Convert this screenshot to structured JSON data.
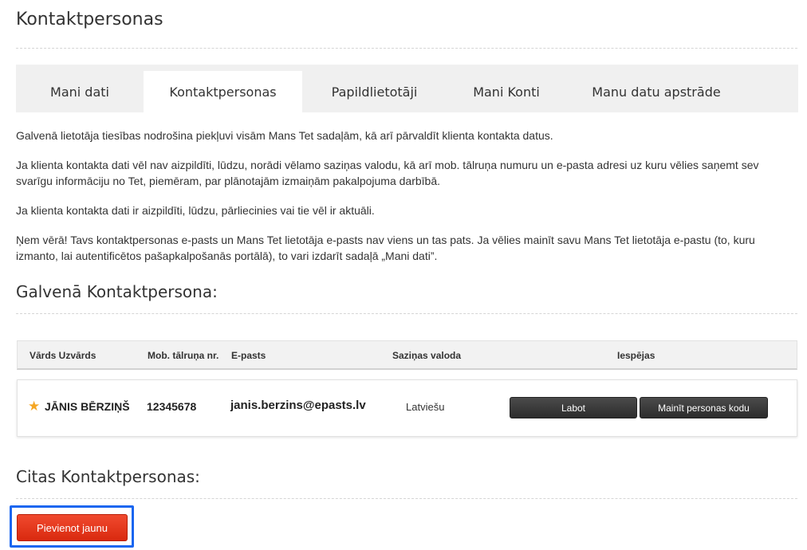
{
  "page_title": "Kontaktpersonas",
  "tabs": [
    {
      "label": "Mani dati"
    },
    {
      "label": "Kontaktpersonas"
    },
    {
      "label": "Papildlietotāji"
    },
    {
      "label": "Mani Konti"
    },
    {
      "label": "Manu datu apstrāde"
    }
  ],
  "active_tab": "Kontaktpersonas",
  "intro": [
    "Galvenā lietotāja tiesības nodrošina piekļuvi visām Mans Tet sadaļām, kā arī pārvaldīt klienta kontakta datus.",
    "Ja klienta kontakta dati vēl nav aizpildīti, lūdzu, norādi vēlamo saziņas valodu, kā arī mob. tālruņa numuru un e-pasta adresi uz kuru vēlies saņemt sev svarīgu informāciju no Tet, piemēram, par plānotajām izmaiņām pakalpojuma darbībā.",
    "Ja klienta kontakta dati ir aizpildīti, lūdzu, pārliecinies vai tie vēl ir aktuāli.",
    "Ņem vērā! Tavs kontaktpersonas e-pasts un Mans Tet lietotāja e-pasts nav viens un tas pats. Ja vēlies mainīt savu Mans Tet lietotāja e-pastu (to, kuru izmanto, lai autentificētos pašapkalpošanās portālā), to vari izdarīt sadaļā „Mani dati”."
  ],
  "main_contact": {
    "heading": "Galvenā Kontaktpersona:",
    "columns": {
      "name": "Vārds Uzvārds",
      "mobile": "Mob. tālruņa nr.",
      "email": "E-pasts",
      "language": "Saziņas valoda",
      "options": "Iespējas"
    },
    "row": {
      "name": "JĀNIS BĒRZIŅŠ",
      "mobile": "12345678",
      "email": "janis.berzins@epasts.lv",
      "language": "Latviešu",
      "edit_label": "Labot",
      "change_code_label": "Mainīt personas kodu"
    }
  },
  "other_contacts": {
    "heading": "Citas Kontaktpersonas:",
    "add_label": "Pievienot jaunu"
  },
  "colors": {
    "accent_red": "#e2351a",
    "highlight_blue": "#1a66f0",
    "star": "#f5a623",
    "tab_bar": "#f0f0f0"
  },
  "icons": {
    "primary_marker": "star-icon"
  }
}
